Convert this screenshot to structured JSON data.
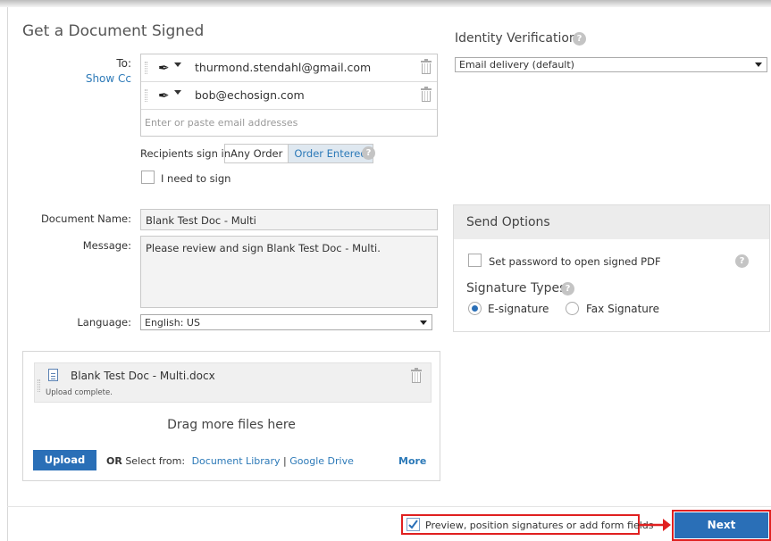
{
  "form": {
    "title": "Get a Document Signed",
    "to_label": "To:",
    "show_cc": "Show Cc",
    "recipients": [
      {
        "email": "thurmond.stendahl@gmail.com"
      },
      {
        "email": "bob@echosign.com"
      }
    ],
    "email_placeholder": "Enter or paste email addresses",
    "sign_order_label": "Recipients sign in",
    "sign_order_options": [
      "Any Order",
      "Order Entered"
    ],
    "sign_order_selected": "Order Entered",
    "i_need_to_sign": "I need to sign",
    "doc_name_label": "Document Name:",
    "doc_name_value": "Blank Test Doc - Multi",
    "message_label": "Message:",
    "message_value": "Please review and sign Blank Test Doc - Multi.",
    "language_label": "Language:",
    "language_value": "English: US"
  },
  "upload": {
    "file_name": "Blank Test Doc - Multi.docx",
    "file_status": "Upload complete.",
    "drag_text": "Drag more files here",
    "upload_button": "Upload",
    "or_select": "OR",
    "select_from": "Select from:",
    "document_library": "Document Library",
    "separator": "|",
    "google_drive": "Google Drive",
    "more": "More"
  },
  "identity": {
    "title": "Identity Verification",
    "select_value": "Email delivery (default)"
  },
  "send_options": {
    "title": "Send Options",
    "password_label": "Set password to open signed PDF",
    "signature_types_label": "Signature Types",
    "types": [
      "E-signature",
      "Fax Signature"
    ],
    "selected_type": "E-signature"
  },
  "footer": {
    "preview_label": "Preview, position signatures or add form fields",
    "preview_checked": true,
    "next_button": "Next"
  },
  "colors": {
    "accent": "#2a6fb7",
    "highlight_red": "#e02020"
  }
}
